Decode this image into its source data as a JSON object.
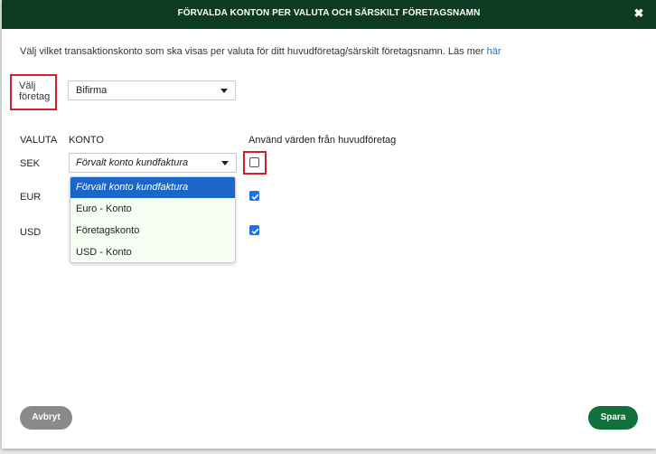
{
  "dialog": {
    "title": "FÖRVALDA KONTON PER VALUTA OCH SÄRSKILT FÖRETAGSNAMN",
    "close_glyph": "✖"
  },
  "intro": {
    "text": "Välj vilket transaktionskonto som ska visas per valuta för ditt huvudföretag/särskilt företagsnamn. Läs mer ",
    "link_label": "här"
  },
  "company": {
    "label_line1": "Välj",
    "label_line2": "företag",
    "selected": "Bifirma"
  },
  "table": {
    "headers": {
      "currency": "VALUTA",
      "account": "KONTO",
      "use_main": "Använd värden från huvudföretag"
    },
    "rows": [
      {
        "currency": "SEK",
        "account": "Förvalt konto kundfaktura",
        "use_main": false
      },
      {
        "currency": "EUR",
        "account": "",
        "use_main": true
      },
      {
        "currency": "USD",
        "account": "",
        "use_main": true
      }
    ]
  },
  "account_dropdown": {
    "options": [
      "Förvalt konto kundfaktura",
      "Euro - Konto",
      "Företagskonto",
      "USD - Konto"
    ],
    "selected_index": 0
  },
  "footer": {
    "cancel_label": "Avbryt",
    "save_label": "Spara"
  },
  "colors": {
    "header_bg": "#0d3b22",
    "accent_green": "#12713a",
    "highlight_red": "#d4202a",
    "selection_blue": "#1a66c9"
  }
}
